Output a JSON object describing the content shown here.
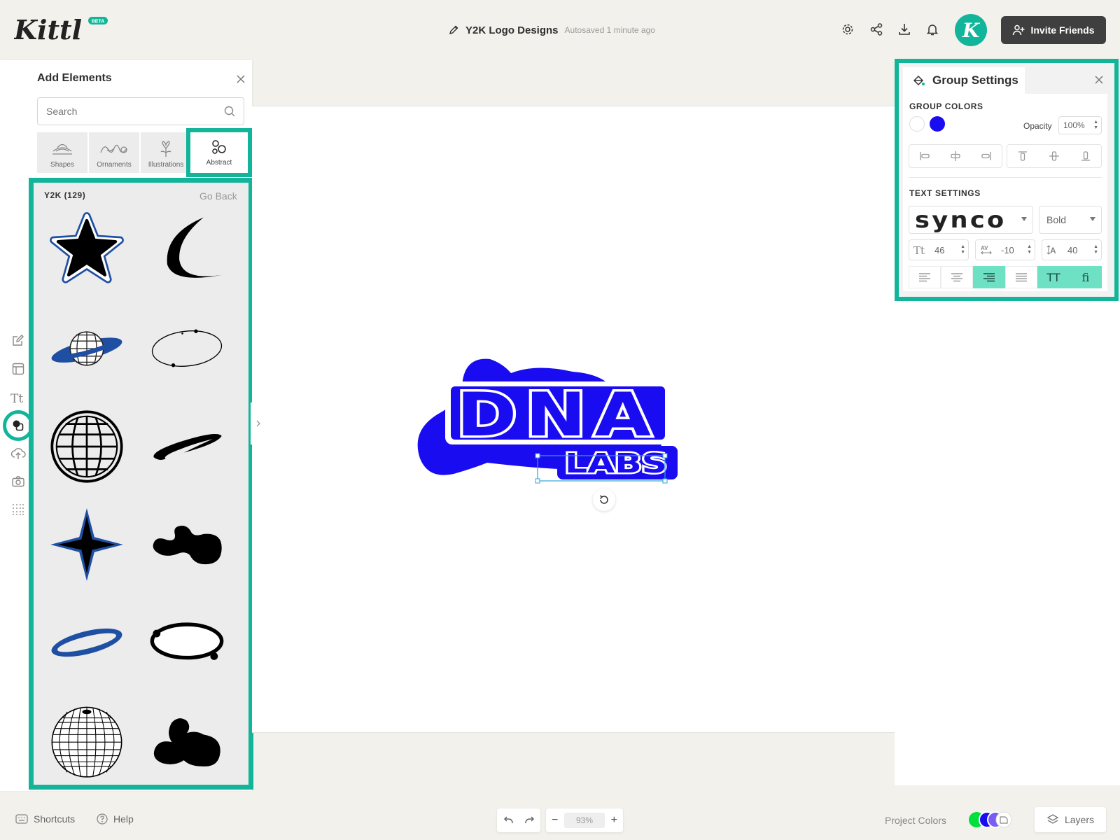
{
  "app": {
    "name": "Kittl",
    "badge": "BETA"
  },
  "document": {
    "title": "Y2K Logo Designs",
    "status": "Autosaved 1 minute ago"
  },
  "header": {
    "avatar_letter": "K",
    "invite_label": "Invite Friends"
  },
  "add_panel": {
    "title": "Add Elements",
    "search_placeholder": "Search",
    "categories": [
      {
        "label": "Shapes",
        "icon": "shapes-icon"
      },
      {
        "label": "Ornaments",
        "icon": "ornaments-icon"
      },
      {
        "label": "Illustrations",
        "icon": "illustrations-icon"
      },
      {
        "label": "Abstract",
        "icon": "abstract-icon",
        "selected": true
      }
    ],
    "collection": {
      "title": "Y2K (129)",
      "back_label": "Go Back"
    },
    "items": [
      "star-outline-icon",
      "crescent-moon-icon",
      "ringed-planet-icon",
      "orbit-ellipse-icon",
      "wireframe-globe-icon",
      "swoosh-ring-icon",
      "four-point-star-icon",
      "blob-icon",
      "blue-ring-icon",
      "oval-orbit-icon",
      "wireframe-sphere-icon",
      "blob-cluster-icon"
    ]
  },
  "canvas": {
    "logo_text_main": "DNA",
    "logo_text_sub": "LABS",
    "logo_color": "#1a0cf0"
  },
  "group_settings": {
    "title": "Group Settings",
    "colors_heading": "GROUP COLORS",
    "swatches": [
      "#ffffff",
      "#1a0cf0"
    ],
    "opacity_label": "Opacity",
    "opacity_value": "100%",
    "text_heading": "TEXT SETTINGS",
    "font_name": "synco",
    "font_weight": "Bold",
    "font_size": "46",
    "letter_spacing": "-10",
    "line_height": "40",
    "case_label": "TT",
    "ligature_label": "fi"
  },
  "footer": {
    "shortcuts_label": "Shortcuts",
    "help_label": "Help",
    "zoom": "93%",
    "project_colors_label": "Project Colors",
    "project_colors": [
      "#00e03c",
      "#1a0cf0",
      "#7b5cf5"
    ],
    "layers_label": "Layers"
  },
  "colors": {
    "accent": "#12b59a",
    "highlight": "#6ee0c4"
  }
}
